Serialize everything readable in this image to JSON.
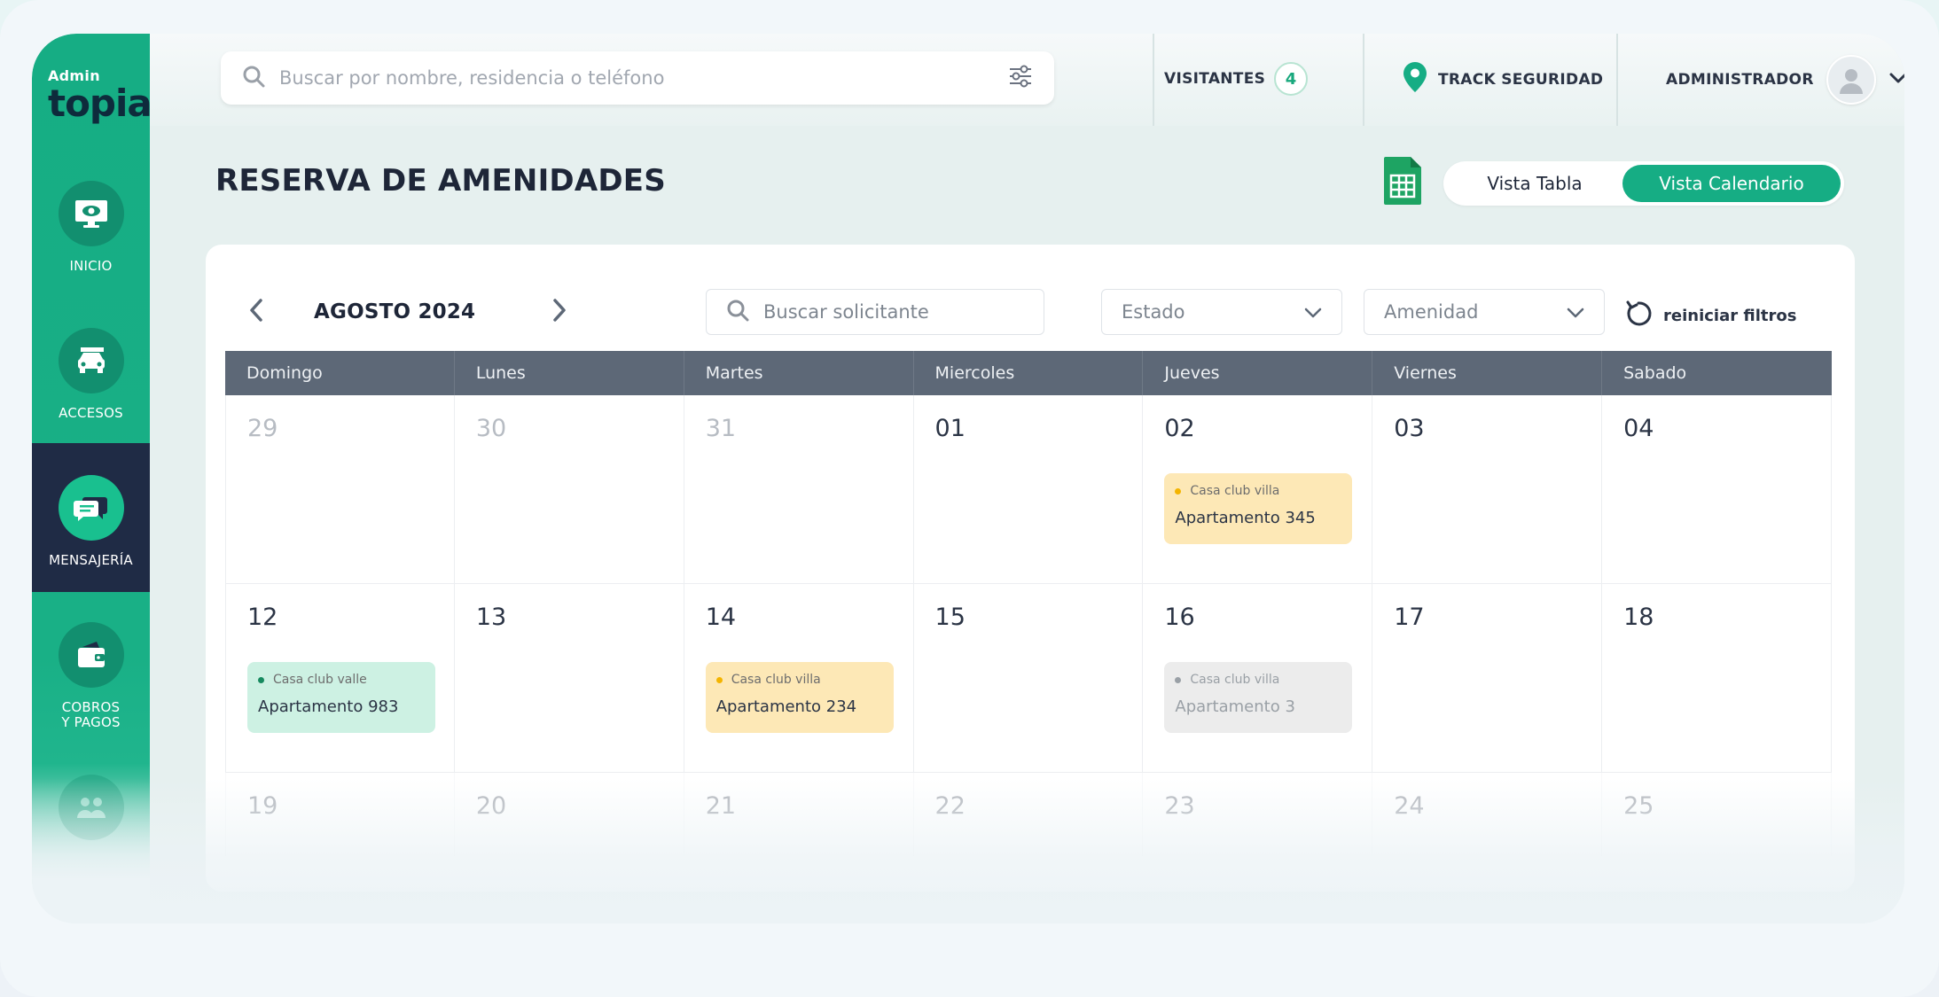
{
  "brand": {
    "small": "Admin",
    "big": "topia"
  },
  "sidebar": {
    "items": [
      {
        "label": "INICIO",
        "icon": "monitor-eye-icon"
      },
      {
        "label": "ACCESOS",
        "icon": "car-icon"
      },
      {
        "label": "MENSAJERÍA",
        "icon": "chat-bubbles-icon",
        "active": true
      },
      {
        "label": "COBROS\nY PAGOS",
        "icon": "wallet-icon"
      },
      {
        "label": "",
        "icon": "users-icon"
      }
    ]
  },
  "topbar": {
    "search_placeholder": "Buscar por nombre, residencia o teléfono",
    "visitors_label": "VISITANTES",
    "visitors_count": "4",
    "track_label": "TRACK SEGURIDAD",
    "admin_label": "ADMINISTRADOR"
  },
  "page": {
    "title": "RESERVA DE AMENIDADES",
    "view_table": "Vista Tabla",
    "view_calendar": "Vista Calendario"
  },
  "calendar": {
    "month": "AGOSTO 2024",
    "search_placeholder": "Buscar solicitante",
    "estado_label": "Estado",
    "amenidad_label": "Amenidad",
    "reset_label": "reiniciar filtros",
    "weekdays": [
      "Domingo",
      "Lunes",
      "Martes",
      "Miercoles",
      "Jueves",
      "Viernes",
      "Sabado"
    ],
    "weeks": [
      [
        "29",
        "30",
        "31",
        "01",
        "02",
        "03",
        "04"
      ],
      [
        "12",
        "13",
        "14",
        "15",
        "16",
        "17",
        "18"
      ],
      [
        "19",
        "20",
        "21",
        "22",
        "23",
        "24",
        "25"
      ]
    ],
    "events": [
      {
        "category": "Casa club villa",
        "title": "Apartamento 345",
        "color": "yellow",
        "dot": "#f4b400"
      },
      {
        "category": "Casa club valle",
        "title": "Apartamento 983",
        "color": "green",
        "dot": "#168a5f"
      },
      {
        "category": "Casa club villa",
        "title": "Apartamento 234",
        "color": "yellow",
        "dot": "#f4b400"
      },
      {
        "category": "Casa club villa",
        "title": "Apartamento 3",
        "color": "grey",
        "dot": "#9aa0a6"
      }
    ]
  },
  "colors": {
    "accent": "#16ad84",
    "sidebar_active": "#1f2b45",
    "header_row": "#5d6877"
  }
}
